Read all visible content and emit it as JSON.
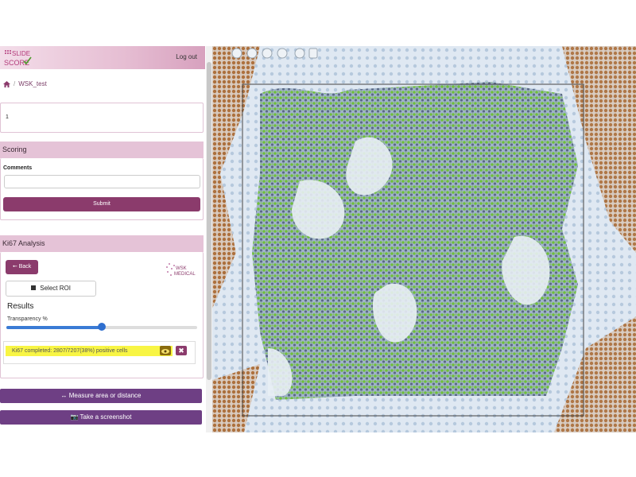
{
  "header": {
    "logo_line1": "SLIDE",
    "logo_line2": "SCORE",
    "logout_label": "Log out"
  },
  "breadcrumb": {
    "home_icon": "home-icon",
    "slide_name": "WSK_test"
  },
  "case_box": {
    "text": "1"
  },
  "scoring": {
    "title": "Scoring",
    "comments_label": "Comments",
    "comments_value": "",
    "submit_label": "Submit"
  },
  "ki67": {
    "title": "Ki67 Analysis",
    "back_label": "Back",
    "brand_line1": "WSK",
    "brand_line2": "MEDICAL",
    "select_roi_label": "Select ROI",
    "results_title": "Results",
    "transparency_label": "Transparency %",
    "transparency_value": 0.5,
    "result_text": "Ki67 completed: 2807/7207(38%) positive cells"
  },
  "tools": {
    "measure_label": "Measure area or distance",
    "screenshot_label": "Take a screenshot"
  },
  "colors": {
    "accent": "#8b3b6c",
    "header_pink": "#e5c3d7",
    "tool_violet": "#6e3f84",
    "positive_cell": "#6fbf3a",
    "negative_cell": "#5b6a86",
    "brown_stain": "#a8642a"
  }
}
